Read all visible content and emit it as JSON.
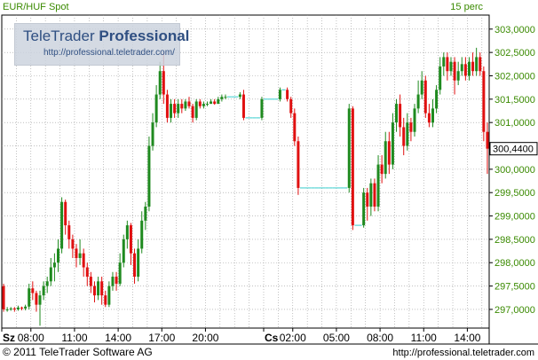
{
  "header": {
    "symbol": "EUR/HUF Spot",
    "interval": "15 perc"
  },
  "watermark": {
    "brand_plain": "TeleTrader ",
    "brand_bold": "Professional",
    "url": "http://professional.teletrader.com/"
  },
  "footer": {
    "copyright": "© 2011 TeleTrader Software AG",
    "url": "http://professional.teletrader.com"
  },
  "colors": {
    "up": "#1f8a1f",
    "down": "#e01010",
    "flat": "#33cccc",
    "grid": "#9a9a9a",
    "text": "#3a8a00"
  },
  "chart_data": {
    "type": "candlestick",
    "title": "EUR/HUF Spot",
    "interval": "15 perc",
    "ylim": [
      296.6,
      303.3
    ],
    "y_ticks": [
      "297,0000",
      "297,5000",
      "298,0000",
      "298,5000",
      "299,0000",
      "299,5000",
      "300,0000",
      "300,5000",
      "301,0000",
      "301,5000",
      "302,0000",
      "302,5000",
      "303,0000"
    ],
    "y_tick_values": [
      297.0,
      297.5,
      298.0,
      298.5,
      299.0,
      299.5,
      300.0,
      300.5,
      301.0,
      301.5,
      302.0,
      302.5,
      303.0
    ],
    "last_value_label": "300,4400",
    "last_value": 300.44,
    "x_ticks": [
      {
        "label": "Sz",
        "index": 0,
        "bold": true
      },
      {
        "label": "08:00",
        "index": 8
      },
      {
        "label": "11:00",
        "index": 20
      },
      {
        "label": "14:00",
        "index": 32
      },
      {
        "label": "17:00",
        "index": 44
      },
      {
        "label": "20:00",
        "index": 56
      },
      {
        "label": "Cs",
        "index": 72,
        "bold": true
      },
      {
        "label": "02:00",
        "index": 80
      },
      {
        "label": "05:00",
        "index": 92
      },
      {
        "label": "08:00",
        "index": 104
      },
      {
        "label": "11:00",
        "index": 116
      },
      {
        "label": "14:00",
        "index": 128
      }
    ],
    "candles": [
      [
        297.5,
        297.0,
        297.55,
        296.95
      ],
      [
        297.0,
        297.0,
        297.05,
        296.95
      ],
      [
        297.0,
        297.02,
        297.05,
        296.97
      ],
      [
        297.02,
        297.0,
        297.05,
        296.95
      ],
      [
        297.0,
        297.04,
        297.08,
        296.97
      ],
      [
        297.04,
        297.02,
        297.06,
        296.98
      ],
      [
        297.02,
        297.06,
        297.1,
        296.98
      ],
      [
        297.06,
        297.45,
        297.55,
        297.0
      ],
      [
        297.45,
        297.35,
        297.6,
        297.2
      ],
      [
        297.35,
        297.1,
        297.4,
        296.95
      ],
      [
        297.1,
        297.3,
        297.4,
        296.65
      ],
      [
        297.3,
        297.5,
        297.6,
        297.2
      ],
      [
        297.5,
        297.6,
        297.7,
        297.35
      ],
      [
        297.6,
        297.9,
        298.1,
        297.5
      ],
      [
        297.9,
        298.0,
        298.2,
        297.6
      ],
      [
        298.0,
        298.3,
        298.5,
        297.8
      ],
      [
        298.3,
        299.3,
        299.4,
        298.2
      ],
      [
        299.3,
        298.8,
        299.35,
        298.6
      ],
      [
        298.8,
        298.5,
        298.9,
        298.3
      ],
      [
        298.5,
        298.3,
        298.6,
        298.1
      ],
      [
        298.3,
        298.1,
        298.4,
        297.9
      ],
      [
        298.1,
        298.2,
        298.5,
        297.95
      ],
      [
        298.2,
        297.9,
        298.3,
        297.7
      ],
      [
        297.9,
        297.7,
        298.0,
        297.5
      ],
      [
        297.7,
        297.5,
        297.8,
        297.35
      ],
      [
        297.5,
        297.3,
        297.6,
        297.15
      ],
      [
        297.3,
        297.6,
        297.7,
        297.2
      ],
      [
        297.6,
        297.3,
        297.7,
        297.1
      ],
      [
        297.3,
        297.1,
        297.4,
        297.05
      ],
      [
        297.1,
        297.5,
        297.6,
        297.05
      ],
      [
        297.5,
        297.7,
        297.8,
        297.4
      ],
      [
        297.7,
        297.55,
        297.8,
        297.4
      ],
      [
        297.55,
        298.0,
        298.2,
        297.5
      ],
      [
        298.0,
        298.5,
        298.6,
        297.9
      ],
      [
        298.5,
        298.8,
        298.9,
        298.3
      ],
      [
        298.8,
        298.2,
        298.85,
        297.95
      ],
      [
        298.2,
        297.7,
        298.3,
        297.55
      ],
      [
        297.7,
        298.3,
        298.5,
        297.6
      ],
      [
        298.3,
        298.9,
        299.1,
        298.2
      ],
      [
        298.9,
        299.2,
        299.3,
        298.7
      ],
      [
        299.2,
        300.5,
        300.7,
        299.1
      ],
      [
        300.5,
        301.0,
        301.2,
        300.4
      ],
      [
        301.0,
        301.6,
        301.8,
        300.9
      ],
      [
        301.6,
        302.1,
        302.3,
        301.5
      ],
      [
        302.1,
        301.6,
        302.5,
        301.4
      ],
      [
        301.6,
        301.1,
        301.7,
        301.0
      ],
      [
        301.1,
        301.4,
        301.5,
        301.0
      ],
      [
        301.4,
        301.2,
        301.5,
        301.1
      ],
      [
        301.2,
        301.4,
        301.5,
        301.1
      ],
      [
        301.4,
        301.3,
        301.5,
        301.2
      ],
      [
        301.3,
        301.45,
        301.5,
        301.25
      ],
      [
        301.45,
        301.35,
        301.55,
        301.3
      ],
      [
        301.35,
        301.1,
        301.4,
        301.0
      ],
      [
        301.1,
        301.45,
        301.5,
        301.05
      ],
      [
        301.45,
        301.35,
        301.5,
        301.3
      ],
      [
        301.35,
        301.4,
        301.45,
        301.3
      ],
      [
        301.4,
        301.4,
        301.45,
        301.35
      ],
      [
        301.4,
        301.45,
        301.5,
        301.4
      ],
      [
        301.45,
        301.4,
        301.5,
        301.38
      ],
      [
        301.4,
        301.5,
        301.55,
        301.4
      ],
      [
        301.5,
        301.55,
        301.6,
        301.45
      ],
      [
        301.55,
        301.55,
        301.6,
        301.5
      ],
      [
        301.55,
        301.55,
        301.57,
        301.53
      ],
      [
        301.55,
        301.55,
        301.57,
        301.53
      ],
      [
        301.55,
        301.55,
        301.57,
        301.53
      ],
      [
        301.55,
        301.6,
        301.65,
        301.5
      ],
      [
        301.6,
        301.1,
        301.7,
        301.05
      ],
      [
        301.1,
        301.1,
        301.12,
        301.08
      ],
      [
        301.1,
        301.1,
        301.12,
        301.08
      ],
      [
        301.1,
        301.1,
        301.12,
        301.08
      ],
      [
        301.1,
        301.1,
        301.12,
        301.08
      ],
      [
        301.1,
        301.5,
        301.55,
        301.05
      ],
      [
        301.5,
        301.5,
        301.52,
        301.48
      ],
      [
        301.5,
        301.5,
        301.52,
        301.48
      ],
      [
        301.5,
        301.5,
        301.52,
        301.48
      ],
      [
        301.5,
        301.5,
        301.52,
        301.48
      ],
      [
        301.5,
        301.7,
        301.75,
        301.45
      ],
      [
        301.7,
        301.7,
        301.72,
        301.68
      ],
      [
        301.7,
        301.5,
        301.75,
        301.45
      ],
      [
        301.5,
        301.2,
        301.55,
        301.1
      ],
      [
        301.2,
        300.6,
        301.3,
        300.5
      ],
      [
        300.6,
        299.6,
        300.7,
        299.45
      ],
      [
        299.6,
        299.6,
        299.62,
        299.58
      ],
      [
        299.6,
        299.6,
        299.62,
        299.58
      ],
      [
        299.6,
        299.6,
        299.62,
        299.58
      ],
      [
        299.6,
        299.6,
        299.62,
        299.58
      ],
      [
        299.6,
        299.6,
        299.62,
        299.58
      ],
      [
        299.6,
        299.6,
        299.62,
        299.58
      ],
      [
        299.6,
        299.6,
        299.62,
        299.58
      ],
      [
        299.6,
        299.6,
        299.62,
        299.58
      ],
      [
        299.6,
        299.6,
        299.62,
        299.58
      ],
      [
        299.6,
        299.6,
        299.62,
        299.58
      ],
      [
        299.6,
        299.6,
        299.62,
        299.58
      ],
      [
        299.6,
        299.6,
        299.62,
        299.58
      ],
      [
        299.6,
        299.6,
        299.62,
        299.58
      ],
      [
        299.6,
        301.3,
        301.4,
        299.5
      ],
      [
        301.3,
        298.8,
        301.35,
        298.7
      ],
      [
        298.8,
        298.8,
        298.82,
        298.78
      ],
      [
        298.8,
        298.8,
        298.82,
        298.78
      ],
      [
        298.8,
        299.5,
        299.6,
        298.75
      ],
      [
        299.5,
        299.2,
        299.6,
        298.9
      ],
      [
        299.2,
        299.7,
        299.8,
        299.0
      ],
      [
        299.7,
        299.2,
        299.8,
        299.1
      ],
      [
        299.2,
        300.1,
        300.3,
        299.1
      ],
      [
        300.1,
        299.9,
        300.3,
        299.7
      ],
      [
        299.9,
        300.6,
        300.8,
        299.8
      ],
      [
        300.6,
        300.1,
        300.8,
        299.9
      ],
      [
        300.1,
        301.0,
        301.2,
        300.0
      ],
      [
        301.0,
        301.4,
        301.5,
        300.8
      ],
      [
        301.4,
        300.9,
        301.6,
        300.7
      ],
      [
        300.9,
        300.5,
        301.1,
        300.3
      ],
      [
        300.5,
        301.0,
        301.2,
        300.4
      ],
      [
        301.0,
        300.8,
        301.1,
        300.6
      ],
      [
        300.8,
        301.3,
        301.4,
        300.7
      ],
      [
        301.3,
        301.6,
        301.9,
        301.2
      ],
      [
        301.6,
        301.9,
        302.1,
        301.5
      ],
      [
        301.9,
        301.2,
        302.0,
        301.1
      ],
      [
        301.2,
        301.0,
        301.4,
        300.9
      ],
      [
        301.0,
        301.3,
        301.5,
        300.9
      ],
      [
        301.3,
        301.7,
        301.8,
        301.2
      ],
      [
        301.7,
        302.2,
        302.4,
        301.6
      ],
      [
        302.2,
        302.4,
        302.5,
        302.0
      ],
      [
        302.4,
        302.1,
        302.5,
        301.9
      ],
      [
        302.1,
        302.3,
        302.4,
        302.0
      ],
      [
        302.3,
        301.9,
        302.4,
        301.6
      ],
      [
        301.9,
        302.1,
        302.3,
        301.8
      ],
      [
        302.1,
        302.25,
        302.4,
        302.0
      ],
      [
        302.25,
        302.0,
        302.4,
        301.9
      ],
      [
        302.0,
        302.3,
        302.4,
        301.9
      ],
      [
        302.3,
        302.1,
        302.5,
        302.0
      ],
      [
        302.1,
        302.4,
        302.6,
        302.0
      ],
      [
        302.4,
        302.1,
        302.5,
        302.0
      ],
      [
        302.1,
        300.8,
        302.2,
        300.6
      ],
      [
        300.8,
        300.44,
        301.0,
        299.9
      ]
    ]
  }
}
